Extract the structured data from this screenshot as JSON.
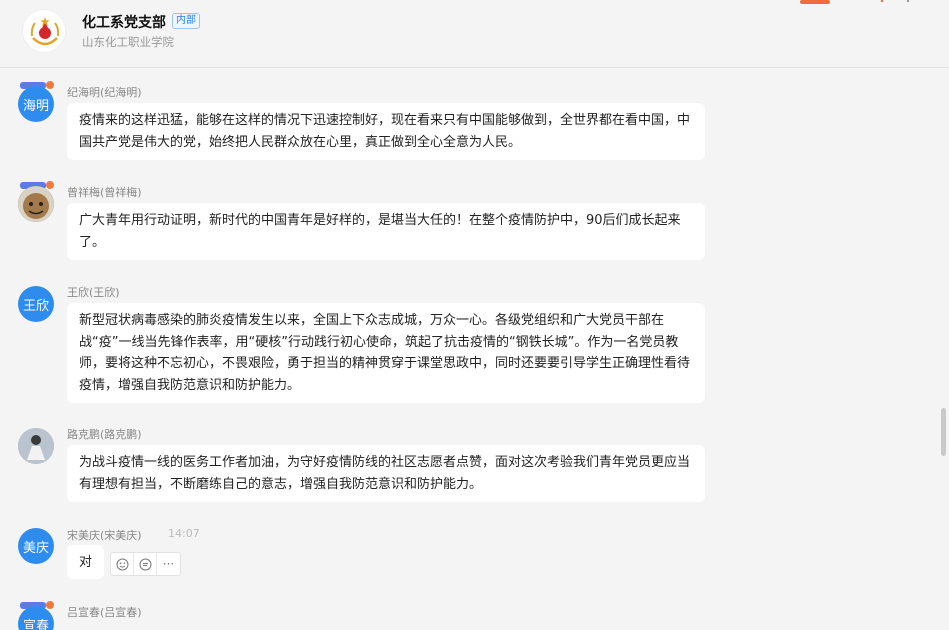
{
  "header": {
    "group_name": "化工系党支部",
    "badge": "内部",
    "org_name": "山东化工职业学院"
  },
  "colors": {
    "accent": "#2f8cef",
    "brand_red": "#d7262b"
  },
  "messages": [
    {
      "sender": "纪海明(纪海明)",
      "avatar_text": "海明",
      "text": "疫情来的这样迅猛，能够在这样的情况下迅速控制好，现在看来只有中国能够做到，全世界都在看中国，中国共产党是伟大的党，始终把人民群众放在心里，真正做到全心全意为人民。"
    },
    {
      "sender": "曾祥梅(曾祥梅)",
      "avatar_icon": "cartoon-face-avatar",
      "text": "广大青年用行动证明，新时代的中国青年是好样的，是堪当大任的！在整个疫情防护中，90后们成长起来了。"
    },
    {
      "sender": "王欣(王欣)",
      "avatar_text": "王欣",
      "text": "新型冠状病毒感染的肺炎疫情发生以来，全国上下众志成城，万众一心。各级党组织和广大党员干部在战“疫”一线当先锋作表率，用“硬核”行动践行初心使命，筑起了抗击疫情的“钢铁长城”。作为一名党员教师，要将这种不忘初心，不畏艰险，勇于担当的精神贯穿于课堂思政中，同时还要要引导学生正确理性看待疫情，增强自我防范意识和防护能力。"
    },
    {
      "sender": "路克鹏(路克鹏)",
      "avatar_icon": "photo-avatar",
      "text": "为战斗疫情一线的医务工作者加油，为守好疫情防线的社区志愿者点赞，面对这次考验我们青年党员更应当有理想有担当，不断磨练自己的意志，增强自我防范意识和防护能力。"
    },
    {
      "sender": "宋美庆(宋美庆)",
      "avatar_text": "美庆",
      "time": "14:07",
      "text": "对"
    },
    {
      "sender": "吕宣春(吕宣春)",
      "avatar_text": "宣春",
      "text": ""
    }
  ],
  "actions": {
    "more": "···"
  }
}
